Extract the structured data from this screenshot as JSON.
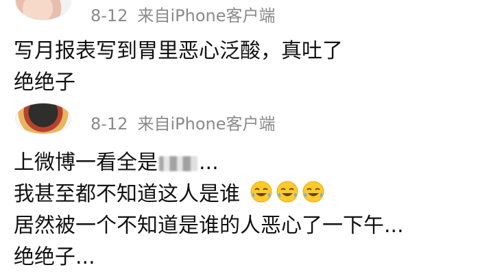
{
  "comments": [
    {
      "date": "8-12",
      "source": "来自iPhone客户端",
      "lines": [
        "写月报表写到胃里恶心泛酸，真吐了",
        "绝绝子"
      ]
    },
    {
      "date": "8-12",
      "source": "来自iPhone客户端",
      "line1_prefix": "上微博一看全是",
      "line1_suffix": "...",
      "line2": "我甚至都不知道这人是谁",
      "line3": "居然被一个不知道是谁的人恶心了一下午...",
      "line4": "绝绝子...",
      "emojis": [
        "joy-emoji",
        "joy-emoji",
        "joy-emoji"
      ]
    }
  ]
}
